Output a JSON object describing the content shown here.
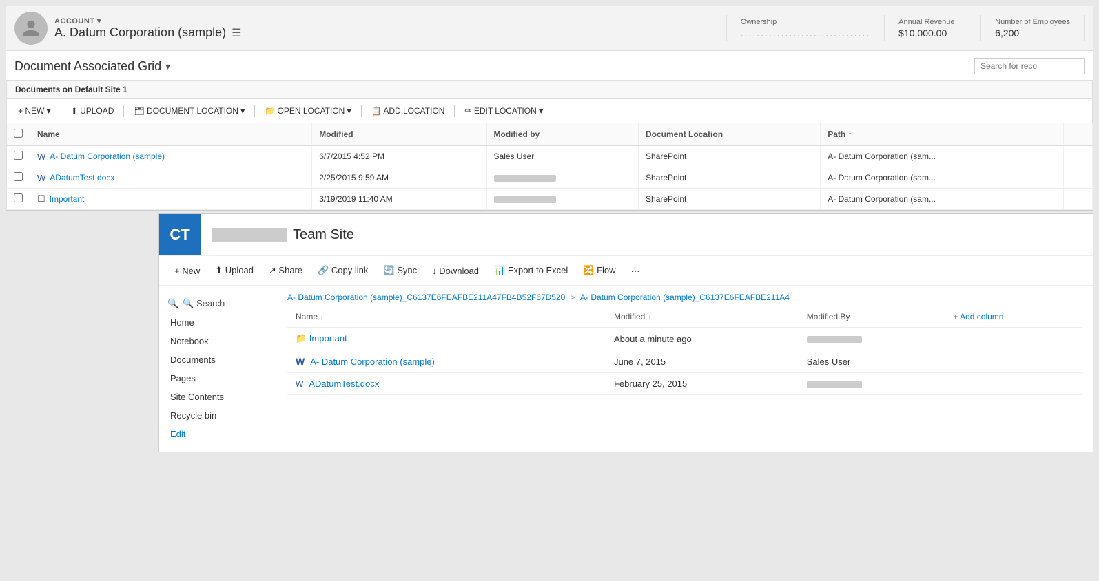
{
  "account": {
    "label": "ACCOUNT ▾",
    "name": "A. Datum Corporation (sample)",
    "ownership_label": "Ownership",
    "ownership_value": "................................",
    "annual_revenue_label": "Annual Revenue",
    "annual_revenue_value": "$10,000.00",
    "employees_label": "Number of Employees",
    "employees_value": "6,200"
  },
  "grid": {
    "title": "Document Associated Grid",
    "chevron": "▾",
    "search_placeholder": "Search for reco",
    "subtitle": "Documents on Default Site 1",
    "toolbar": {
      "new_label": "+ NEW ▾",
      "upload_label": "⬆ UPLOAD",
      "document_location_label": "🗂 DOCUMENT LOCATION ▾",
      "open_location_label": "📁 OPEN LOCATION ▾",
      "add_location_label": "📋 ADD LOCATION",
      "edit_location_label": "✏ EDIT LOCATION ▾"
    },
    "columns": [
      "Name",
      "Modified",
      "Modified by",
      "Document Location",
      "Path ↑"
    ],
    "rows": [
      {
        "type": "word",
        "name": "A- Datum Corporation (sample)",
        "modified": "6/7/2015 4:52 PM",
        "modified_by": "Sales User",
        "doc_location": "SharePoint",
        "path": "A- Datum Corporation (sam..."
      },
      {
        "type": "word",
        "name": "ADatumTest.docx",
        "modified": "2/25/2015 9:59 AM",
        "modified_by": "blurred",
        "doc_location": "SharePoint",
        "path": "A- Datum Corporation (sam..."
      },
      {
        "type": "page",
        "name": "Important",
        "modified": "3/19/2019 11:40 AM",
        "modified_by": "blurred",
        "doc_location": "SharePoint",
        "path": "A- Datum Corporation (sam..."
      }
    ]
  },
  "sharepoint": {
    "logo": "CT",
    "blurred_name": "",
    "site_name": "Team Site",
    "toolbar": {
      "new_label": "+ New",
      "upload_label": "⬆ Upload",
      "share_label": "↗ Share",
      "copy_link_label": "🔗 Copy link",
      "sync_label": "🔄 Sync",
      "download_label": "↓ Download",
      "export_label": "📊 Export to Excel",
      "flow_label": "🔀 Flow",
      "more_label": "···"
    },
    "nav": {
      "search_label": "🔍 Search",
      "items": [
        "Home",
        "Notebook",
        "Documents",
        "Pages",
        "Site Contents",
        "Recycle bin",
        "Edit"
      ]
    },
    "breadcrumb": {
      "part1": "A- Datum Corporation (sample)_C6137E6FEAFBE211A47FB4B52F67D520",
      "sep": ">",
      "part2": "A- Datum Corporation (sample)_C6137E6FEAFBE211A4"
    },
    "table": {
      "columns": [
        "Name ↓",
        "Modified ↓",
        "Modified By ↓",
        ""
      ],
      "add_col": "+ Add column",
      "rows": [
        {
          "type": "folder",
          "name": "Important",
          "modified": "About a minute ago",
          "modified_by": "blurred"
        },
        {
          "type": "word",
          "name": "A- Datum Corporation (sample)",
          "modified": "June 7, 2015",
          "modified_by": "Sales User"
        },
        {
          "type": "word_small",
          "name": "ADatumTest.docx",
          "modified": "February 25, 2015",
          "modified_by": "blurred"
        }
      ]
    }
  }
}
